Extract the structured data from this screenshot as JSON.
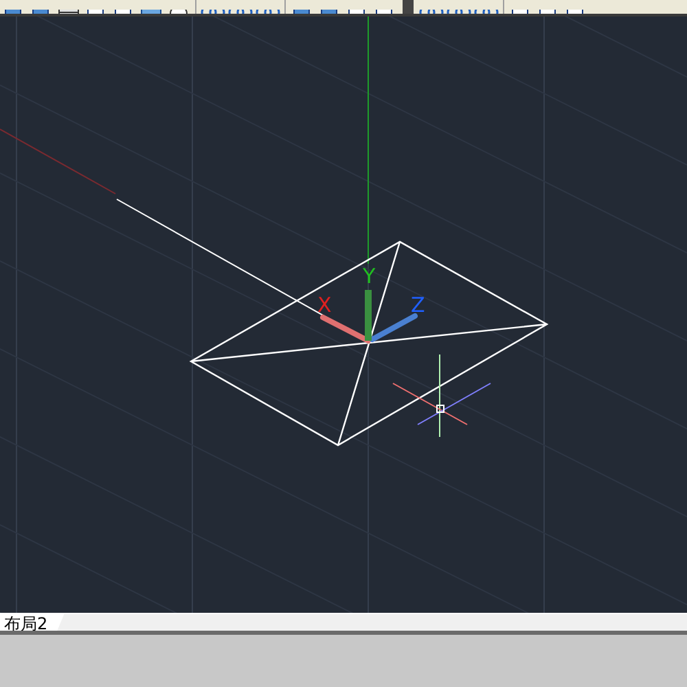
{
  "ucs_icon": {
    "x_label": "X",
    "y_label": "Y",
    "z_label": "Z"
  },
  "layout_tabs": [
    {
      "label": "布局2",
      "selected": true
    }
  ]
}
